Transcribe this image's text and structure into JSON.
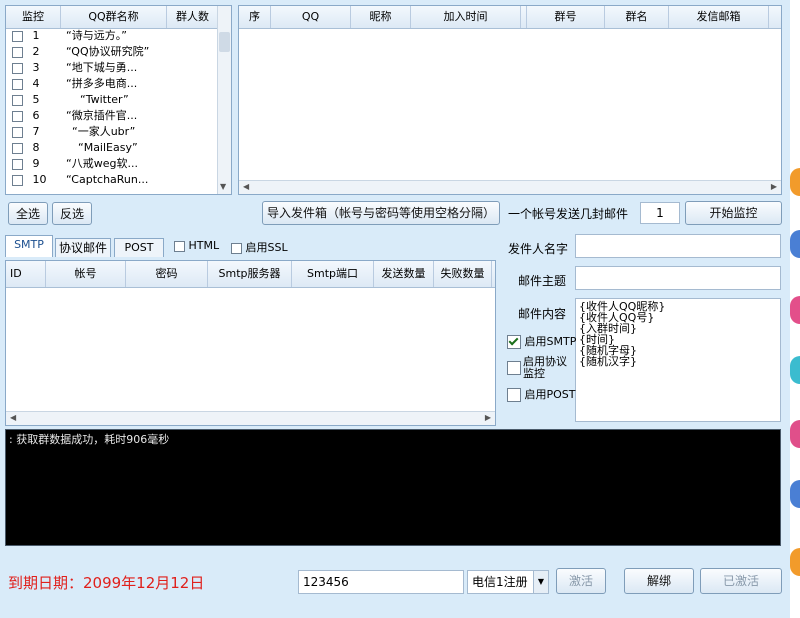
{
  "group_list": {
    "columns": [
      "监控",
      "QQ群名称",
      "群人数"
    ],
    "rows": [
      {
        "num": "1",
        "name": "“诗与远方。”"
      },
      {
        "num": "2",
        "name": "“QQ协议研究院”"
      },
      {
        "num": "3",
        "name": "“地下城与勇..."
      },
      {
        "num": "4",
        "name": "“拼多多电商..."
      },
      {
        "num": "5",
        "name": "“Twitter”"
      },
      {
        "num": "6",
        "name": "“微京插件官..."
      },
      {
        "num": "7",
        "name": "“一家人ubr”"
      },
      {
        "num": "8",
        "name": "“MailEasy”"
      },
      {
        "num": "9",
        "name": "“八戒weg软..."
      },
      {
        "num": "10",
        "name": "“CaptchaRun..."
      }
    ]
  },
  "member_table": {
    "columns": [
      "序",
      "QQ",
      "昵称",
      "加入时间",
      "",
      "群号",
      "群名",
      "发信邮箱"
    ]
  },
  "buttons": {
    "select_all": "全选",
    "invert": "反选",
    "import": "导入发件箱（帐号与密码等使用空格分隔）",
    "start": "开始监控",
    "activate": "激活",
    "unbind": "解绑",
    "activated": "已激活"
  },
  "per_account_label": "一个帐号发送几封邮件",
  "per_account_value": "1",
  "tabs": {
    "smtp": "SMTP",
    "protocol": "协议邮件",
    "post": "POST"
  },
  "options": {
    "html": "HTML",
    "ssl": "启用SSL"
  },
  "smtp_table": {
    "columns": [
      "ID",
      "帐号",
      "密码",
      "Smtp服务器",
      "Smtp端口",
      "发送数量",
      "失败数量"
    ]
  },
  "form": {
    "sender_label": "发件人名字",
    "sender_value": "",
    "subject_label": "邮件主题",
    "subject_value": "",
    "content_label": "邮件内容",
    "content_lines": [
      "{收件人QQ昵称}",
      "{收件人QQ号}",
      "{入群时间}",
      "{时间}",
      "{随机字母}",
      "{随机汉字}"
    ],
    "enable_smtp": "启用SMTP",
    "enable_protocol_1": "启用协议",
    "enable_protocol_2": "监控",
    "enable_post": "启用POST"
  },
  "log": {
    "line": ": 获取群数据成功，耗时906毫秒"
  },
  "footer": {
    "expiry": "到期日期：2099年12月12日",
    "code": "123456",
    "line": "电信1注册"
  },
  "colors": {
    "window_bg": "#d9ebf9",
    "log_bg": "#000000",
    "expiry_text": "#e0201c"
  }
}
